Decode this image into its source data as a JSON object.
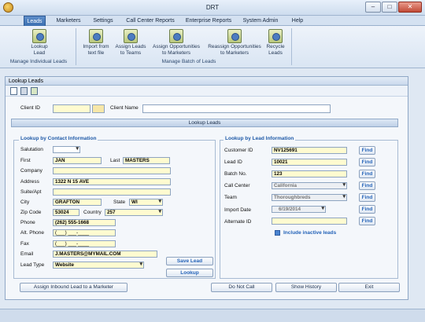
{
  "window": {
    "title": "DRT",
    "minimize": "–",
    "maximize": "□",
    "close": "✕"
  },
  "menu_tabs": [
    "Leads",
    "Marketers",
    "Settings",
    "Call Center Reports",
    "Enterprise Reports",
    "System Admin",
    "Help"
  ],
  "ribbon": {
    "lookup": {
      "line1": "Lookup",
      "line2": "Lead"
    },
    "import": {
      "line1": "Import from",
      "line2": "text file"
    },
    "assign_leads": {
      "line1": "Assign Leads",
      "line2": "to Teams"
    },
    "assign_opps": {
      "line1": "Assign Opportunities",
      "line2": "to Marketers"
    },
    "reassign_opps": {
      "line1": "Reassign Opportunities",
      "line2": "to Marketers"
    },
    "recycle": {
      "line1": "Recycle",
      "line2": "Leads"
    },
    "group_individual": "Manage Individual Leads",
    "group_batch": "Manage Batch of Leads"
  },
  "panel": {
    "title": "Lookup Leads",
    "client_id_label": "Client ID",
    "client_id_value": "",
    "client_name_label": "Client Name",
    "client_name_value": "",
    "section_header": "Lookup Leads"
  },
  "contact": {
    "legend": "Lookup by Contact Information",
    "salutation_label": "Salutation",
    "salutation_value": "",
    "first_label": "First",
    "first_value": "JAN",
    "last_label": "Last",
    "last_value": "MASTERS",
    "company_label": "Company",
    "company_value": "",
    "address_label": "Address",
    "address_value": "1322 N 15 AVE",
    "suite_label": "Suite/Apt",
    "suite_value": "",
    "city_label": "City",
    "city_value": "GRAFTON",
    "state_label": "State",
    "state_value": "WI",
    "zip_label": "Zip Code",
    "zip_value": "53024",
    "country_label": "Country",
    "country_value": "257",
    "phone_label": "Phone",
    "phone_value": "(262) 555-1668",
    "alt_phone_label": "Alt. Phone",
    "alt_phone_value": "(___) ___-____",
    "fax_label": "Fax",
    "fax_value": "(___) ___-____",
    "email_label": "Email",
    "email_value": "J.MASTERS@MYMAIL.COM",
    "lead_type_label": "Lead Type",
    "lead_type_value": "Website",
    "save_lead": "Save Lead",
    "lookup": "Lookup"
  },
  "lead_info": {
    "legend": "Lookup by Lead Information",
    "customer_id_label": "Customer ID",
    "customer_id_value": "NV125691",
    "lead_id_label": "Lead ID",
    "lead_id_value": "10021",
    "batch_no_label": "Batch No.",
    "batch_no_value": "123",
    "call_center_label": "Call Center",
    "call_center_value": "California",
    "team_label": "Team",
    "team_value": "Thoroughbreds",
    "import_date_label": "Import Date",
    "import_date_value": "6/19/2014",
    "alternate_id_label": "Alternate ID",
    "alternate_id_value": "",
    "find": "Find",
    "include_inactive": "Include inactive leads"
  },
  "bottom_buttons": {
    "assign_inbound": "Assign Inbound Lead to a Marketer",
    "do_not_call": "Do Not Call",
    "show_history": "Show History",
    "exit": "Exit"
  }
}
